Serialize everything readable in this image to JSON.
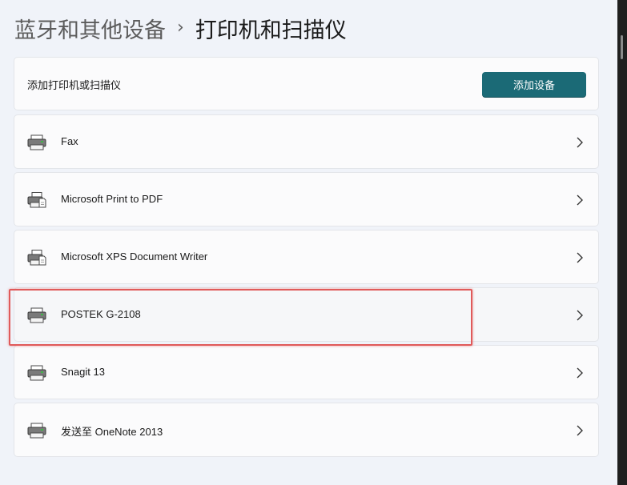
{
  "breadcrumb": {
    "parent": "蓝牙和其他设备",
    "separator": "›",
    "current": "打印机和扫描仪"
  },
  "add_section": {
    "label": "添加打印机或扫描仪",
    "button_label": "添加设备"
  },
  "devices": [
    {
      "name": "Fax",
      "icon": "printer-icon"
    },
    {
      "name": "Microsoft Print to PDF",
      "icon": "printer-document-icon"
    },
    {
      "name": "Microsoft XPS Document Writer",
      "icon": "printer-document-icon"
    },
    {
      "name": "POSTEK G-2108",
      "icon": "printer-icon",
      "highlighted": true
    },
    {
      "name": "Snagit 13",
      "icon": "printer-icon"
    },
    {
      "name": "发送至 OneNote 2013",
      "icon": "printer-icon"
    }
  ],
  "colors": {
    "accent_button": "#1b6a76",
    "highlight_box": "#e05a5a",
    "page_background": "#f0f3f9",
    "card_background": "#fbfbfc"
  }
}
